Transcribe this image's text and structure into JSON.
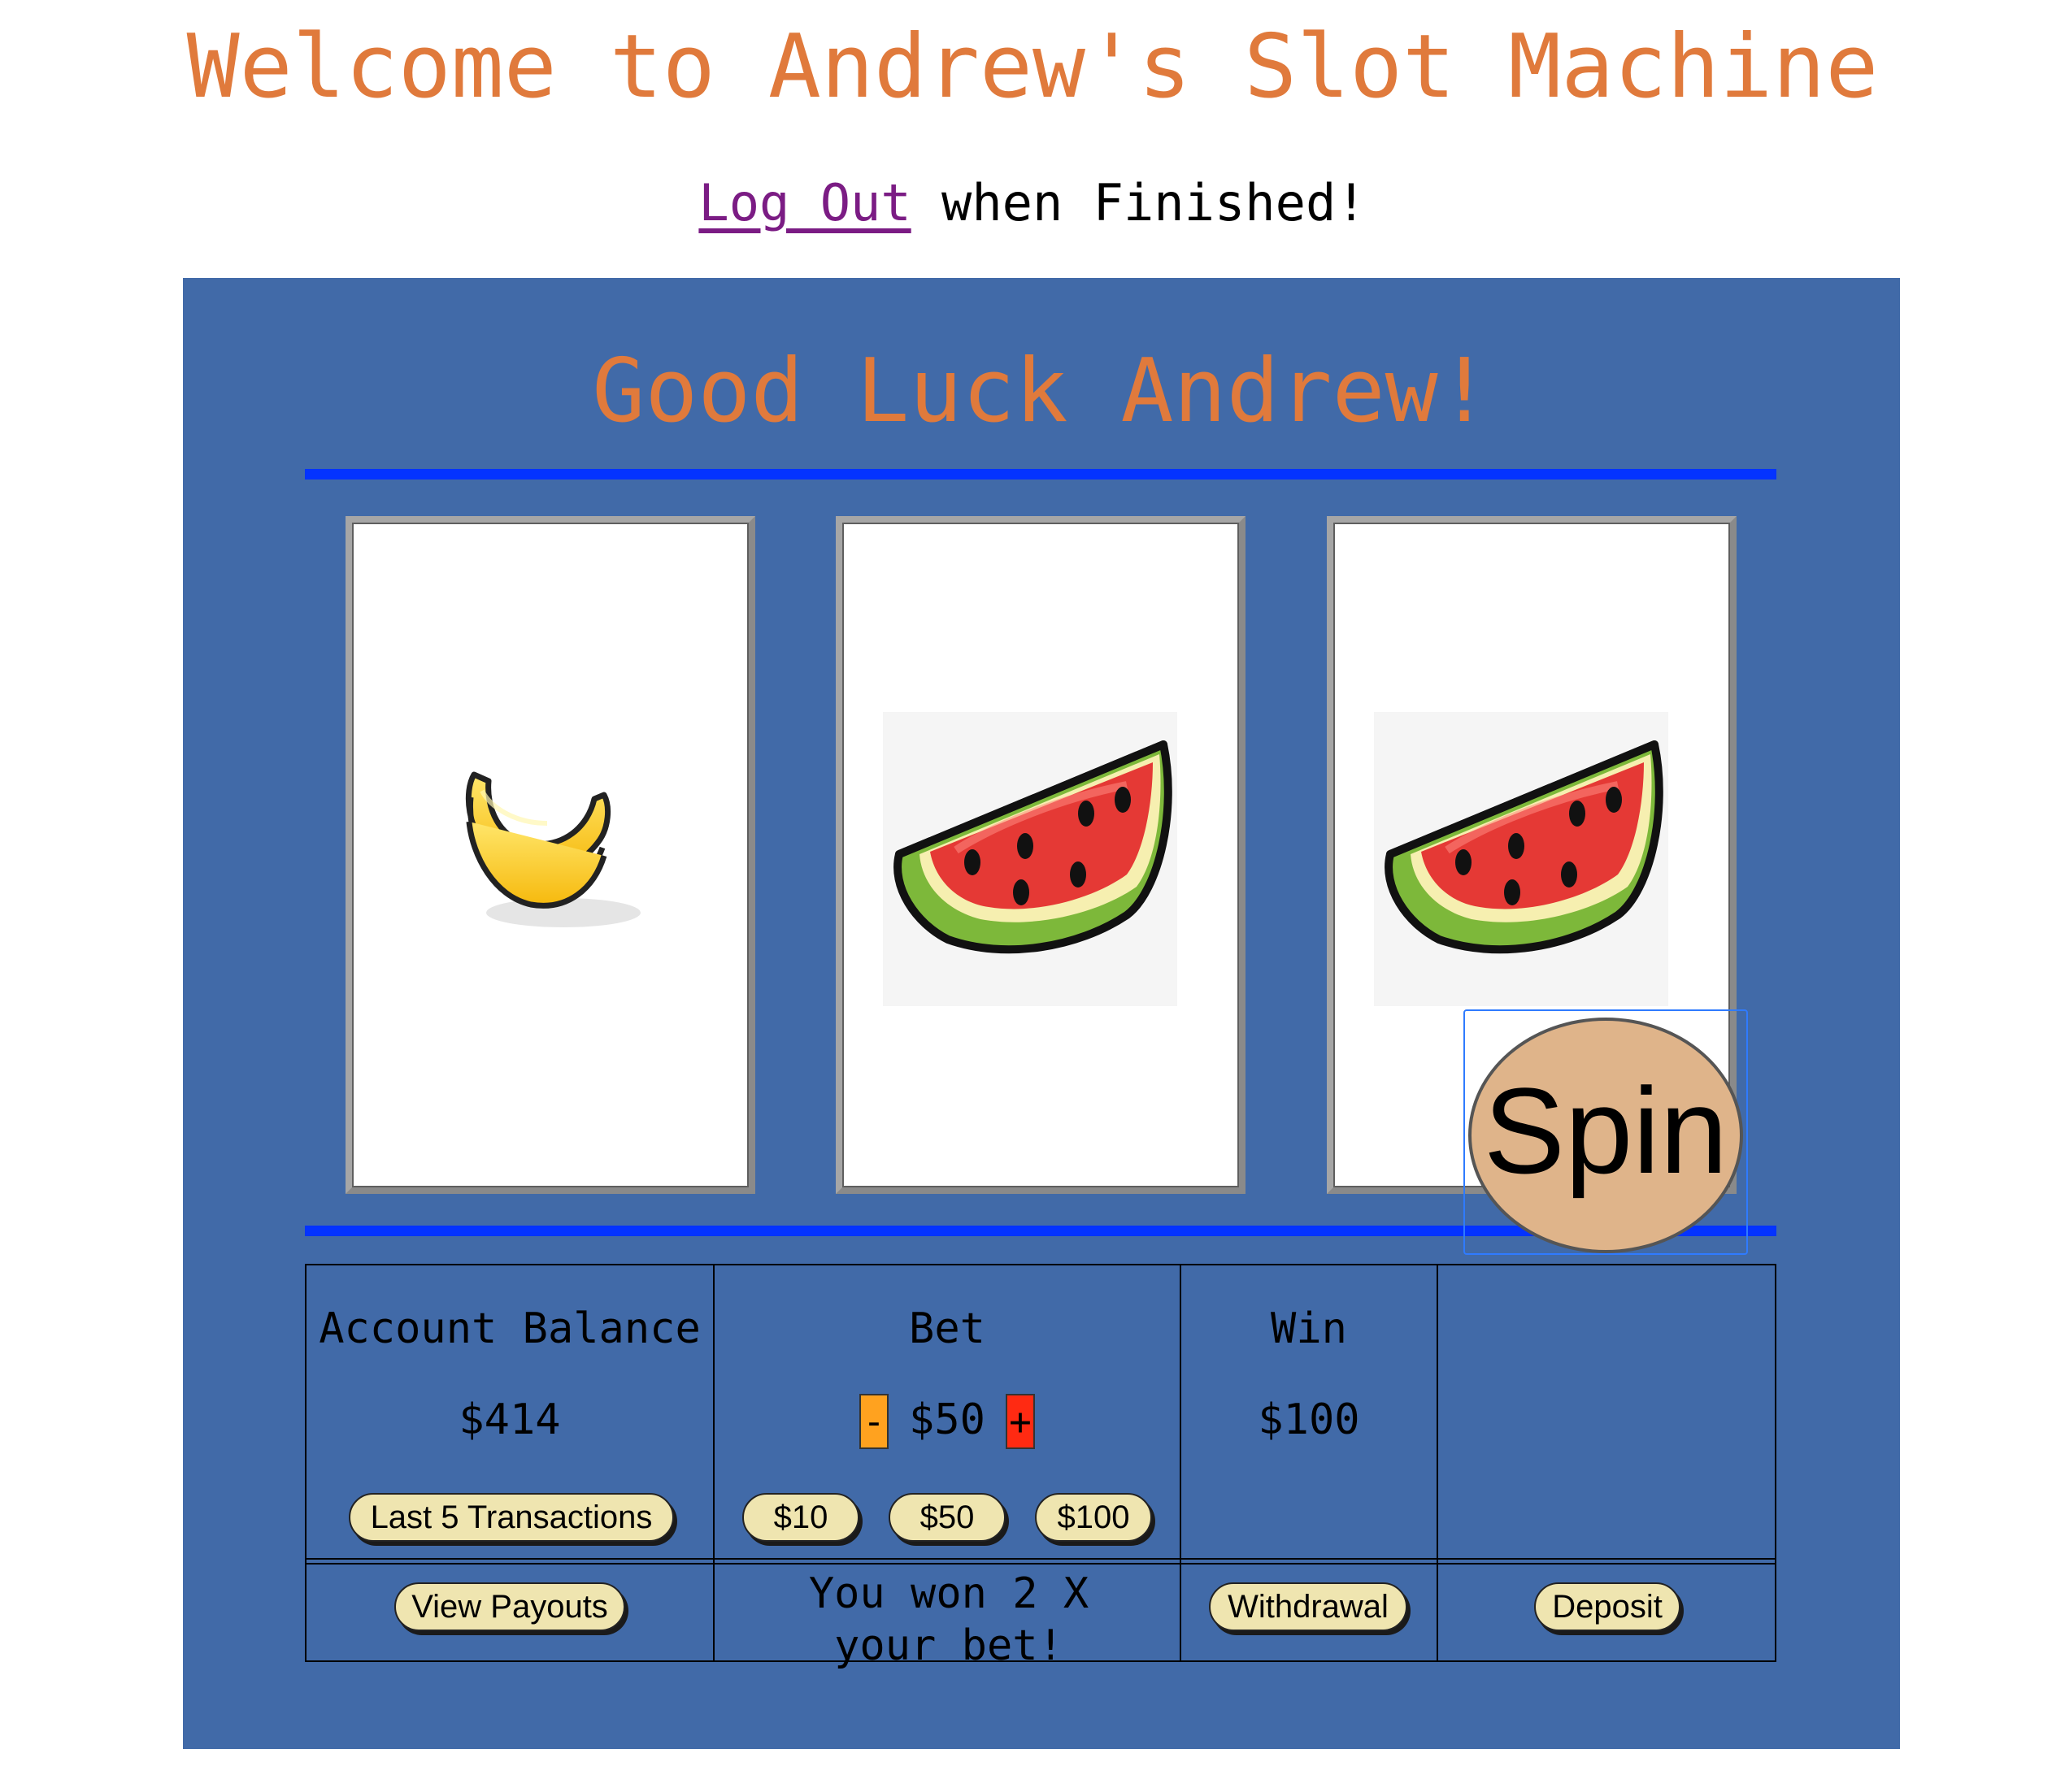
{
  "header": {
    "title": "Welcome to Andrew's Slot Machine",
    "logout_link": "Log Out",
    "logout_suffix": " when Finished!"
  },
  "machine": {
    "greeting": "Good Luck Andrew!",
    "reels": [
      {
        "symbol": "banana-icon"
      },
      {
        "symbol": "watermelon-icon"
      },
      {
        "symbol": "watermelon-icon"
      }
    ]
  },
  "panel": {
    "balance_label": "Account Balance",
    "balance_value": "$414",
    "last_transactions_button": "Last 5 Transactions",
    "bet_label": "Bet",
    "bet_minus": "-",
    "bet_value": "$50",
    "bet_plus": "+",
    "bet_presets": [
      "$10",
      "$50",
      "$100"
    ],
    "win_label": "Win",
    "win_value": "$100",
    "spin_button": "Spin",
    "view_payouts_button": "View Payouts",
    "message": "You won 2 X your bet!",
    "withdrawal_button": "Withdrawal",
    "deposit_button": "Deposit"
  },
  "colors": {
    "title": "#E07A3C",
    "machine_bg": "#416AA8",
    "rule": "#0433FF",
    "pill": "#EFE5B0",
    "spin": "#DFB48A",
    "minus": "#FFA21F",
    "plus": "#FF2A12",
    "link": "#7B1C84"
  }
}
